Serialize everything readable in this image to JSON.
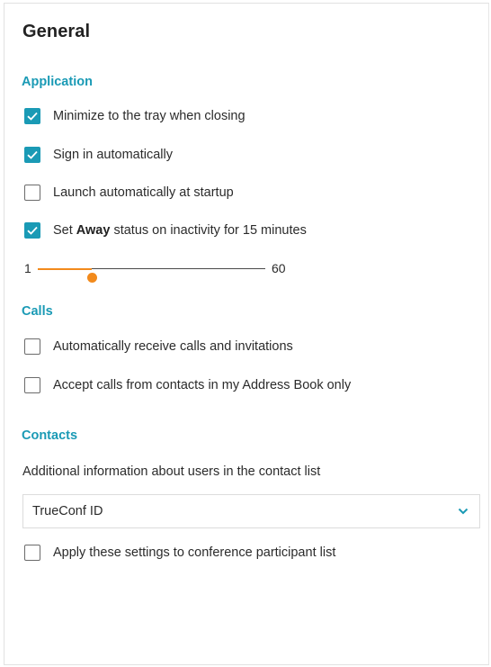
{
  "title": "General",
  "sections": {
    "application": "Application",
    "calls": "Calls",
    "contacts": "Contacts"
  },
  "application": {
    "minimize_tray": {
      "label": "Minimize to the tray when closing",
      "checked": true
    },
    "sign_in_auto": {
      "label": "Sign in automatically",
      "checked": true
    },
    "launch_startup": {
      "label": "Launch automatically at startup",
      "checked": false
    },
    "away_status": {
      "prefix": "Set ",
      "bold": "Away",
      "suffix": " status on inactivity for 15 minutes",
      "checked": true
    },
    "slider": {
      "min": "1",
      "max": "60",
      "value": 15
    }
  },
  "calls": {
    "auto_receive": {
      "label": "Automatically receive calls and invitations",
      "checked": false
    },
    "address_book_only": {
      "label": "Accept calls from contacts in my Address Book only",
      "checked": false
    }
  },
  "contacts": {
    "description": "Additional information about users in the contact list",
    "dropdown_value": "TrueConf ID",
    "apply_participants": {
      "label": "Apply these settings to conference participant list",
      "checked": false
    }
  },
  "colors": {
    "accent": "#1a9ab5",
    "slider": "#f28a1c"
  },
  "icons": {
    "check": "checkmark-icon",
    "dropdown": "chevron-down-icon"
  }
}
